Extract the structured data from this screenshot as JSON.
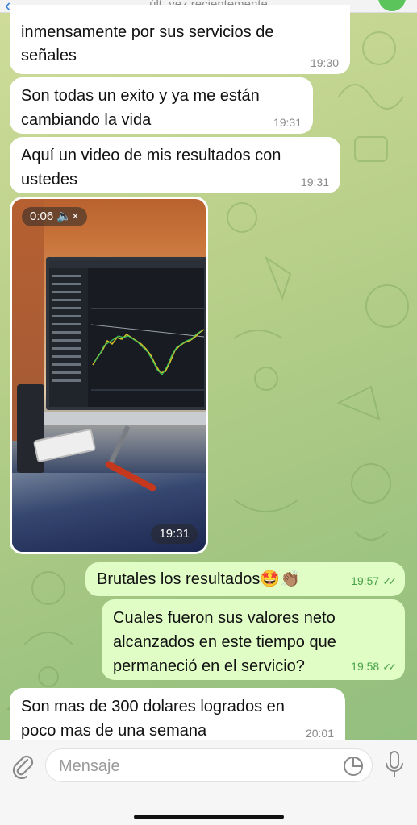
{
  "header": {
    "status": "últ. vez recientemente"
  },
  "messages": [
    {
      "text": "inmensamente por sus servicios de\nseñales",
      "time": "19:30"
    },
    {
      "text": "Son todas un exito y ya me están\ncambiando la vida",
      "time": "19:31"
    },
    {
      "text": "Aquí un video de mis resultados con\nustedes",
      "time": "19:31"
    },
    {
      "video_badge": "0:06 🔈×",
      "time": "19:31"
    },
    {
      "text": "Brutales los resultados🤩👏🏽",
      "time": "19:57"
    },
    {
      "text": "Cuales fueron sus valores neto\nalcanzados en este tiempo que\npermaneció en el servicio?",
      "time": "19:58"
    },
    {
      "text": "Son mas de 300 dolares logrados en\npoco mas de una semana",
      "time": "20:01"
    }
  ],
  "input": {
    "placeholder": "Mensaje"
  },
  "colors": {
    "incoming_bubble": "#ffffff",
    "outgoing_bubble": "#e0fdc6",
    "outgoing_time": "#4aa34a",
    "accent": "#2f7fd9"
  },
  "icons": [
    "back-icon",
    "attach-icon",
    "sticker-icon",
    "microphone-icon",
    "read-checks-icon",
    "mute-icon"
  ]
}
